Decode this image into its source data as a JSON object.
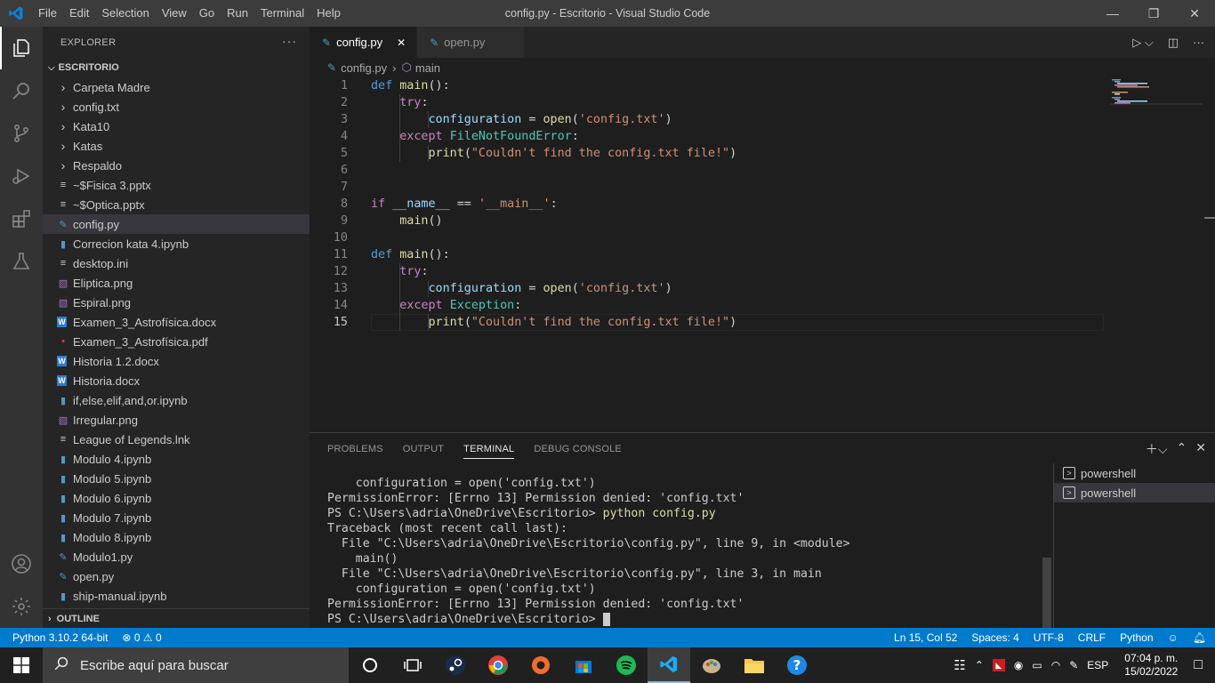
{
  "titlebar": {
    "menu": [
      "File",
      "Edit",
      "Selection",
      "View",
      "Go",
      "Run",
      "Terminal",
      "Help"
    ],
    "title": "config.py - Escritorio - Visual Studio Code"
  },
  "sidebar": {
    "header": "EXPLORER",
    "folder": "ESCRITORIO",
    "items": [
      {
        "label": "Carpeta Madre",
        "kind": "folder"
      },
      {
        "label": "config.txt",
        "kind": "folder"
      },
      {
        "label": "Kata10",
        "kind": "folder"
      },
      {
        "label": "Katas",
        "kind": "folder"
      },
      {
        "label": "Respaldo",
        "kind": "folder"
      },
      {
        "label": "~$Fisica 3.pptx",
        "kind": "text"
      },
      {
        "label": "~$Optica.pptx",
        "kind": "text"
      },
      {
        "label": "config.py",
        "kind": "python",
        "selected": true
      },
      {
        "label": "Correcion kata 4.ipynb",
        "kind": "notebook"
      },
      {
        "label": "desktop.ini",
        "kind": "text"
      },
      {
        "label": "Eliptica.png",
        "kind": "image"
      },
      {
        "label": "Espiral.png",
        "kind": "image"
      },
      {
        "label": "Examen_3_Astrofísica.docx",
        "kind": "word"
      },
      {
        "label": "Examen_3_Astrofísica.pdf",
        "kind": "pdf"
      },
      {
        "label": "Historia 1.2.docx",
        "kind": "word"
      },
      {
        "label": "Historia.docx",
        "kind": "word"
      },
      {
        "label": "if,else,elif,and,or.ipynb",
        "kind": "notebook"
      },
      {
        "label": "Irregular.png",
        "kind": "image"
      },
      {
        "label": "League of Legends.lnk",
        "kind": "text"
      },
      {
        "label": "Modulo 4.ipynb",
        "kind": "notebook"
      },
      {
        "label": "Modulo 5.ipynb",
        "kind": "notebook"
      },
      {
        "label": "Modulo 6.ipynb",
        "kind": "notebook"
      },
      {
        "label": "Modulo 7.ipynb",
        "kind": "notebook"
      },
      {
        "label": "Modulo 8.ipynb",
        "kind": "notebook"
      },
      {
        "label": "Modulo1.py",
        "kind": "python"
      },
      {
        "label": "open.py",
        "kind": "python"
      },
      {
        "label": "ship-manual.ipynb",
        "kind": "notebook"
      }
    ],
    "outline": "OUTLINE"
  },
  "tabs": [
    {
      "label": "config.py",
      "active": true
    },
    {
      "label": "open.py",
      "active": false
    }
  ],
  "breadcrumb": {
    "file": "config.py",
    "symbol": "main"
  },
  "code": [
    [
      [
        "def",
        "kw"
      ],
      [
        " ",
        ""
      ],
      [
        "main",
        "fn"
      ],
      [
        "():",
        ""
      ]
    ],
    [
      [
        "    ",
        ""
      ],
      [
        "try",
        "ctl"
      ],
      [
        ":",
        ""
      ]
    ],
    [
      [
        "        ",
        ""
      ],
      [
        "configuration",
        "var"
      ],
      [
        " = ",
        ""
      ],
      [
        "open",
        "fn"
      ],
      [
        "(",
        ""
      ],
      [
        "'config.txt'",
        "str"
      ],
      [
        ")",
        ""
      ]
    ],
    [
      [
        "    ",
        ""
      ],
      [
        "except",
        "ctl"
      ],
      [
        " ",
        ""
      ],
      [
        "FileNotFoundError",
        "cls"
      ],
      [
        ":",
        ""
      ]
    ],
    [
      [
        "        ",
        ""
      ],
      [
        "print",
        "fn"
      ],
      [
        "(",
        ""
      ],
      [
        "\"Couldn't find the config.txt file!\"",
        "str"
      ],
      [
        ")",
        ""
      ]
    ],
    [],
    [],
    [
      [
        "if",
        "ctl"
      ],
      [
        " ",
        ""
      ],
      [
        "__name__",
        "var"
      ],
      [
        " == ",
        ""
      ],
      [
        "'__main__'",
        "str"
      ],
      [
        ":",
        ""
      ]
    ],
    [
      [
        "    ",
        ""
      ],
      [
        "main",
        "fn"
      ],
      [
        "()",
        ""
      ]
    ],
    [],
    [
      [
        "def",
        "kw"
      ],
      [
        " ",
        ""
      ],
      [
        "main",
        "fn"
      ],
      [
        "():",
        ""
      ]
    ],
    [
      [
        "    ",
        ""
      ],
      [
        "try",
        "ctl"
      ],
      [
        ":",
        ""
      ]
    ],
    [
      [
        "        ",
        ""
      ],
      [
        "configuration",
        "var"
      ],
      [
        " = ",
        ""
      ],
      [
        "open",
        "fn"
      ],
      [
        "(",
        ""
      ],
      [
        "'config.txt'",
        "str"
      ],
      [
        ")",
        ""
      ]
    ],
    [
      [
        "    ",
        ""
      ],
      [
        "except",
        "ctl"
      ],
      [
        " ",
        ""
      ],
      [
        "Exception",
        "cls"
      ],
      [
        ":",
        ""
      ]
    ],
    [
      [
        "        ",
        ""
      ],
      [
        "print",
        "fn"
      ],
      [
        "(",
        ""
      ],
      [
        "\"Couldn't find the config.txt file!\"",
        "str"
      ],
      [
        ")",
        ""
      ]
    ]
  ],
  "current_line": 15,
  "panel": {
    "tabs": [
      "PROBLEMS",
      "OUTPUT",
      "TERMINAL",
      "DEBUG CONSOLE"
    ],
    "active_tab": "TERMINAL",
    "terminal_lines": [
      "    configuration = open('config.txt')",
      "PermissionError: [Errno 13] Permission denied: 'config.txt'",
      "PS C:\\Users\\adria\\OneDrive\\Escritorio> ",
      "Traceback (most recent call last):",
      "  File \"C:\\Users\\adria\\OneDrive\\Escritorio\\config.py\", line 9, in <module>",
      "    main()",
      "  File \"C:\\Users\\adria\\OneDrive\\Escritorio\\config.py\", line 3, in main",
      "    configuration = open('config.txt')",
      "PermissionError: [Errno 13] Permission denied: 'config.txt'",
      "PS C:\\Users\\adria\\OneDrive\\Escritorio> "
    ],
    "command": "python config.py",
    "terminals": [
      "powershell",
      "powershell"
    ]
  },
  "status": {
    "interpreter": "Python 3.10.2 64-bit",
    "errors": "0",
    "warnings": "0",
    "position": "Ln 15, Col 52",
    "spaces": "Spaces: 4",
    "encoding": "UTF-8",
    "eol": "CRLF",
    "language": "Python"
  },
  "taskbar": {
    "search_placeholder": "Escribe aquí para buscar",
    "lang": "ESP",
    "time": "07:04 p. m.",
    "date": "15/02/2022"
  },
  "colors": {
    "accent": "#007acc",
    "titlebar": "#3c3c3c",
    "sidebar": "#252526",
    "editor": "#1e1e1e"
  }
}
